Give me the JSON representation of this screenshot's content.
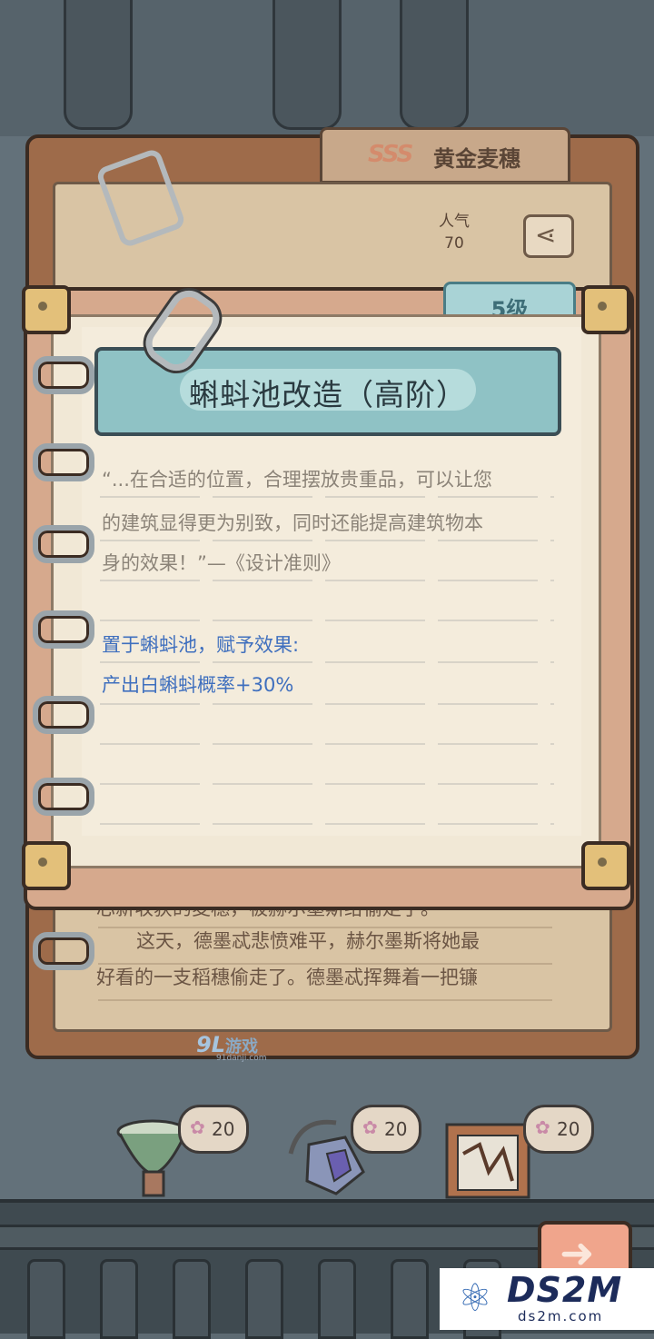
{
  "back_card": {
    "rank_label": "SSS",
    "item_name": "黄金麦穗",
    "stat_label": "人气",
    "stat_value": "70",
    "story_lines": [
      "芯新收获的麦穗，被赫尔墨斯给偷走了。",
      "这天，德墨忒悲愤难平，赫尔墨斯将她最",
      "好看的一支稻穗偷走了。德墨忒挥舞着一把镰"
    ]
  },
  "front_card": {
    "level": "5级",
    "title": "蝌蚪池改造（高阶）",
    "quote_lines": [
      "“...在合适的位置，合理摆放贵重品，可以让您",
      "的建筑显得更为别致，同时还能提高建筑物本",
      "身的效果！”—《设计准则》"
    ],
    "effect_heading": "置于蝌蚪池，赋予效果:",
    "effect_value": "产出白蝌蚪概率+30%"
  },
  "bottom_items": [
    {
      "icon": "flower-icon",
      "cost": "20"
    },
    {
      "icon": "flower-icon",
      "cost": "20"
    },
    {
      "icon": "flower-icon",
      "cost": "20"
    }
  ],
  "icons": {
    "share": "share-icon",
    "next": "arrow-right-icon",
    "cost": "flower-icon"
  },
  "watermarks": {
    "game_site": "9L",
    "game_site_text": "游戏",
    "game_site_url": "91danji.com",
    "logo_main": "DS2M",
    "logo_url": "ds2m.com"
  },
  "colors": {
    "title_bar": "#8fc2c5",
    "effect_text": "#3f6fbe",
    "paper": "#f1e8d6"
  }
}
